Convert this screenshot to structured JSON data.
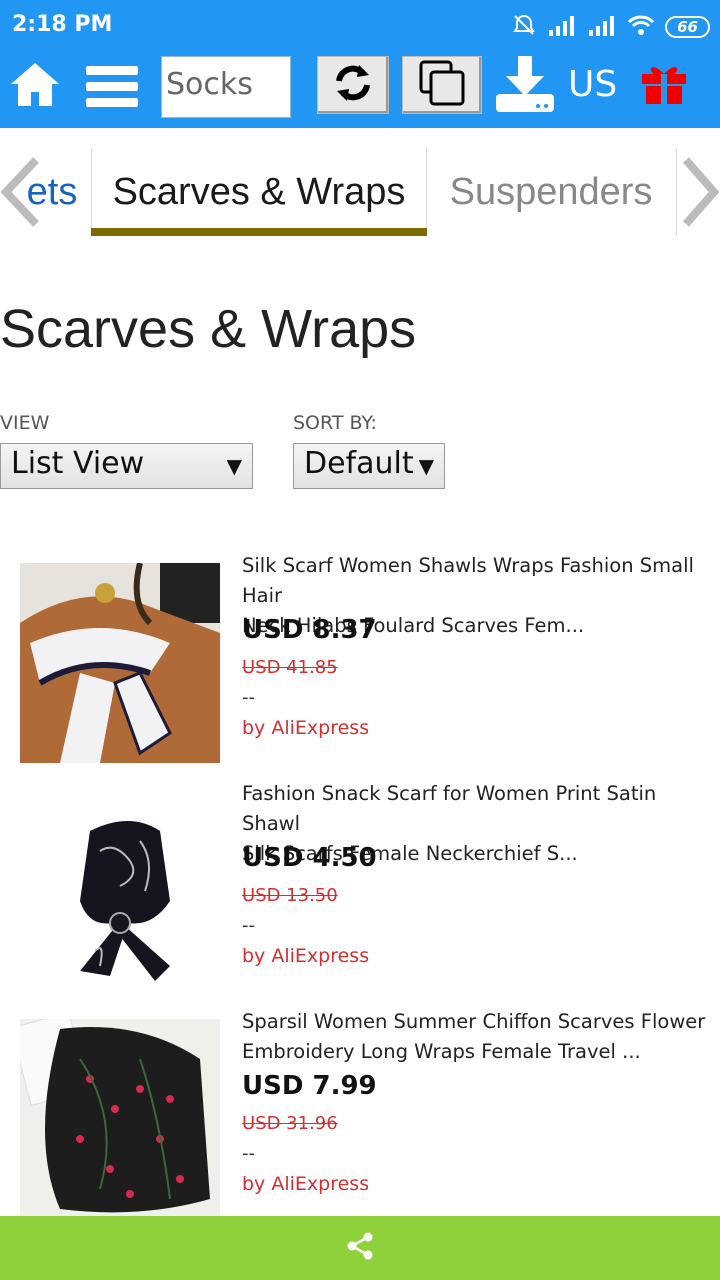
{
  "status_bar": {
    "time": "2:18 PM",
    "battery": "66"
  },
  "toolbar": {
    "search_value": "Socks",
    "region": "US",
    "icons": [
      "home-icon",
      "menu-icon",
      "refresh-icon",
      "copy-icon",
      "download-icon",
      "gift-icon"
    ]
  },
  "tabs": {
    "items": [
      "ets",
      "Scarves & Wraps",
      "Suspenders"
    ],
    "active_index": 1
  },
  "page": {
    "heading": "Scarves & Wraps"
  },
  "controls": {
    "view_label": "VIEW",
    "view_value": "List View",
    "sort_label": "SORT BY:",
    "sort_value": "Default"
  },
  "products": [
    {
      "title_line1": "Silk Scarf Women Shawls Wraps Fashion Small Hair",
      "title_line2": "Neck Hijabs Foulard Scarves Fem...",
      "price": "USD 8.37",
      "old_price": "USD 41.85",
      "dash": "--",
      "seller": "by AliExpress"
    },
    {
      "title_line1": "Fashion Snack Scarf for Women Print Satin Shawl",
      "title_line2": "Silk Scarfs Female Neckerchief S...",
      "price": "USD 4.50",
      "old_price": "USD 13.50",
      "dash": "--",
      "seller": "by AliExpress"
    },
    {
      "title_line1": "Sparsil Women Summer Chiffon Scarves Flower",
      "title_line2": "Embroidery Long Wraps Female Travel ...",
      "price": "USD 7.99",
      "old_price": "USD 31.96",
      "dash": "--",
      "seller": "by AliExpress"
    }
  ],
  "colors": {
    "header_blue": "#2196f3",
    "tab_underline": "#7a6a00",
    "old_price_red": "#d32f2f",
    "bottom_bar_green": "#8fd13b"
  }
}
